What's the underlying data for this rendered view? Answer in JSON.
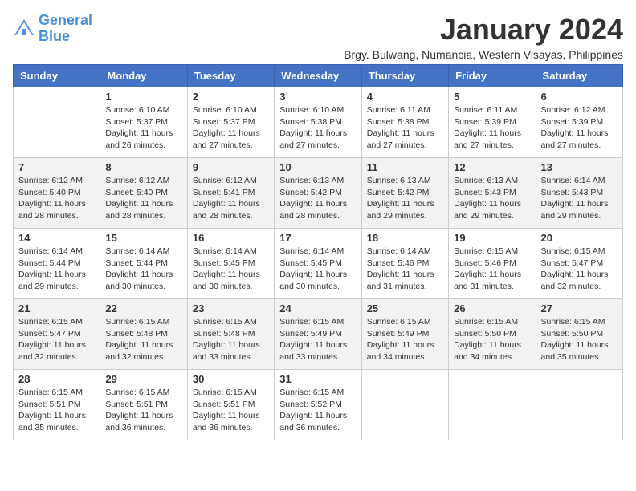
{
  "header": {
    "logo_line1": "General",
    "logo_line2": "Blue",
    "title": "January 2024",
    "subtitle": "Brgy. Bulwang, Numancia, Western Visayas, Philippines"
  },
  "calendar": {
    "days_of_week": [
      "Sunday",
      "Monday",
      "Tuesday",
      "Wednesday",
      "Thursday",
      "Friday",
      "Saturday"
    ],
    "weeks": [
      [
        {
          "day": "",
          "info": ""
        },
        {
          "day": "1",
          "info": "Sunrise: 6:10 AM\nSunset: 5:37 PM\nDaylight: 11 hours\nand 26 minutes."
        },
        {
          "day": "2",
          "info": "Sunrise: 6:10 AM\nSunset: 5:37 PM\nDaylight: 11 hours\nand 27 minutes."
        },
        {
          "day": "3",
          "info": "Sunrise: 6:10 AM\nSunset: 5:38 PM\nDaylight: 11 hours\nand 27 minutes."
        },
        {
          "day": "4",
          "info": "Sunrise: 6:11 AM\nSunset: 5:38 PM\nDaylight: 11 hours\nand 27 minutes."
        },
        {
          "day": "5",
          "info": "Sunrise: 6:11 AM\nSunset: 5:39 PM\nDaylight: 11 hours\nand 27 minutes."
        },
        {
          "day": "6",
          "info": "Sunrise: 6:12 AM\nSunset: 5:39 PM\nDaylight: 11 hours\nand 27 minutes."
        }
      ],
      [
        {
          "day": "7",
          "info": "Sunrise: 6:12 AM\nSunset: 5:40 PM\nDaylight: 11 hours\nand 28 minutes."
        },
        {
          "day": "8",
          "info": "Sunrise: 6:12 AM\nSunset: 5:40 PM\nDaylight: 11 hours\nand 28 minutes."
        },
        {
          "day": "9",
          "info": "Sunrise: 6:12 AM\nSunset: 5:41 PM\nDaylight: 11 hours\nand 28 minutes."
        },
        {
          "day": "10",
          "info": "Sunrise: 6:13 AM\nSunset: 5:42 PM\nDaylight: 11 hours\nand 28 minutes."
        },
        {
          "day": "11",
          "info": "Sunrise: 6:13 AM\nSunset: 5:42 PM\nDaylight: 11 hours\nand 29 minutes."
        },
        {
          "day": "12",
          "info": "Sunrise: 6:13 AM\nSunset: 5:43 PM\nDaylight: 11 hours\nand 29 minutes."
        },
        {
          "day": "13",
          "info": "Sunrise: 6:14 AM\nSunset: 5:43 PM\nDaylight: 11 hours\nand 29 minutes."
        }
      ],
      [
        {
          "day": "14",
          "info": "Sunrise: 6:14 AM\nSunset: 5:44 PM\nDaylight: 11 hours\nand 29 minutes."
        },
        {
          "day": "15",
          "info": "Sunrise: 6:14 AM\nSunset: 5:44 PM\nDaylight: 11 hours\nand 30 minutes."
        },
        {
          "day": "16",
          "info": "Sunrise: 6:14 AM\nSunset: 5:45 PM\nDaylight: 11 hours\nand 30 minutes."
        },
        {
          "day": "17",
          "info": "Sunrise: 6:14 AM\nSunset: 5:45 PM\nDaylight: 11 hours\nand 30 minutes."
        },
        {
          "day": "18",
          "info": "Sunrise: 6:14 AM\nSunset: 5:46 PM\nDaylight: 11 hours\nand 31 minutes."
        },
        {
          "day": "19",
          "info": "Sunrise: 6:15 AM\nSunset: 5:46 PM\nDaylight: 11 hours\nand 31 minutes."
        },
        {
          "day": "20",
          "info": "Sunrise: 6:15 AM\nSunset: 5:47 PM\nDaylight: 11 hours\nand 32 minutes."
        }
      ],
      [
        {
          "day": "21",
          "info": "Sunrise: 6:15 AM\nSunset: 5:47 PM\nDaylight: 11 hours\nand 32 minutes."
        },
        {
          "day": "22",
          "info": "Sunrise: 6:15 AM\nSunset: 5:48 PM\nDaylight: 11 hours\nand 32 minutes."
        },
        {
          "day": "23",
          "info": "Sunrise: 6:15 AM\nSunset: 5:48 PM\nDaylight: 11 hours\nand 33 minutes."
        },
        {
          "day": "24",
          "info": "Sunrise: 6:15 AM\nSunset: 5:49 PM\nDaylight: 11 hours\nand 33 minutes."
        },
        {
          "day": "25",
          "info": "Sunrise: 6:15 AM\nSunset: 5:49 PM\nDaylight: 11 hours\nand 34 minutes."
        },
        {
          "day": "26",
          "info": "Sunrise: 6:15 AM\nSunset: 5:50 PM\nDaylight: 11 hours\nand 34 minutes."
        },
        {
          "day": "27",
          "info": "Sunrise: 6:15 AM\nSunset: 5:50 PM\nDaylight: 11 hours\nand 35 minutes."
        }
      ],
      [
        {
          "day": "28",
          "info": "Sunrise: 6:15 AM\nSunset: 5:51 PM\nDaylight: 11 hours\nand 35 minutes."
        },
        {
          "day": "29",
          "info": "Sunrise: 6:15 AM\nSunset: 5:51 PM\nDaylight: 11 hours\nand 36 minutes."
        },
        {
          "day": "30",
          "info": "Sunrise: 6:15 AM\nSunset: 5:51 PM\nDaylight: 11 hours\nand 36 minutes."
        },
        {
          "day": "31",
          "info": "Sunrise: 6:15 AM\nSunset: 5:52 PM\nDaylight: 11 hours\nand 36 minutes."
        },
        {
          "day": "",
          "info": ""
        },
        {
          "day": "",
          "info": ""
        },
        {
          "day": "",
          "info": ""
        }
      ]
    ]
  }
}
